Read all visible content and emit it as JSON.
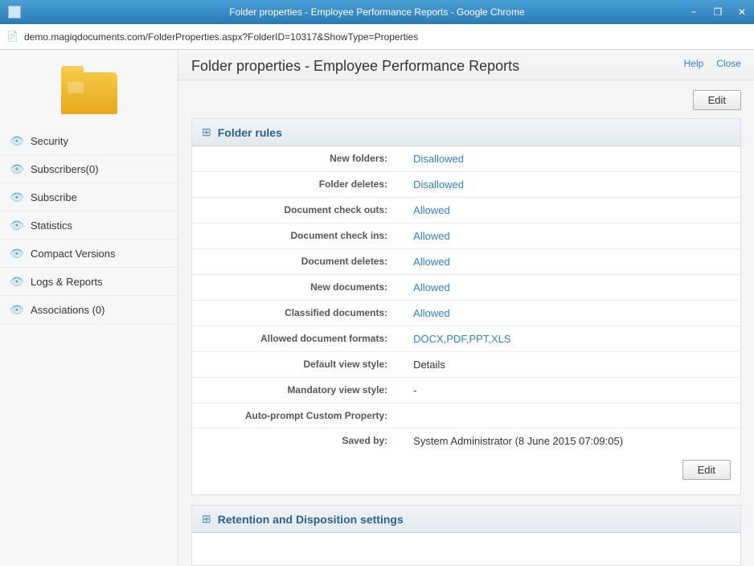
{
  "window": {
    "title": "Folder properties - Employee Performance Reports - Google Chrome",
    "minimize_label": "−",
    "restore_label": "❐",
    "close_label": "✕"
  },
  "address_bar": {
    "url": "demo.magiqdocuments.com/FolderProperties.aspx?FolderID=10317&ShowType=Properties"
  },
  "header": {
    "title": "Folder properties - Employee Performance Reports",
    "help_label": "Help",
    "close_label": "Close"
  },
  "sidebar": {
    "items": [
      {
        "id": "security",
        "label": "Security"
      },
      {
        "id": "subscribers",
        "label": "Subscribers(0)"
      },
      {
        "id": "subscribe",
        "label": "Subscribe"
      },
      {
        "id": "statistics",
        "label": "Statistics"
      },
      {
        "id": "compact-versions",
        "label": "Compact Versions"
      },
      {
        "id": "logs-reports",
        "label": "Logs & Reports"
      },
      {
        "id": "associations",
        "label": "Associations (0)"
      }
    ]
  },
  "edit_button_label": "Edit",
  "folder_rules": {
    "section_title": "Folder rules",
    "properties": [
      {
        "label": "New folders:",
        "value": "Disallowed",
        "type": "link"
      },
      {
        "label": "Folder deletes:",
        "value": "Disallowed",
        "type": "link"
      },
      {
        "label": "Document check outs:",
        "value": "Allowed",
        "type": "link"
      },
      {
        "label": "Document check ins:",
        "value": "Allowed",
        "type": "link"
      },
      {
        "label": "Document deletes:",
        "value": "Allowed",
        "type": "link"
      },
      {
        "label": "New documents:",
        "value": "Allowed",
        "type": "link"
      },
      {
        "label": "Classified documents:",
        "value": "Allowed",
        "type": "link"
      },
      {
        "label": "Allowed document formats:",
        "value": "DOCX,PDF,PPT,XLS",
        "type": "link"
      },
      {
        "label": "Default view style:",
        "value": "Details",
        "type": "plain"
      },
      {
        "label": "Mandatory view style:",
        "value": "-",
        "type": "plain"
      },
      {
        "label": "Auto-prompt Custom Property:",
        "value": "",
        "type": "plain"
      },
      {
        "label": "Saved by:",
        "value": "System Administrator (8 June 2015 07:09:05)",
        "type": "plain"
      }
    ],
    "edit_button_label": "Edit"
  },
  "retention_section": {
    "section_title": "Retention and Disposition settings"
  }
}
